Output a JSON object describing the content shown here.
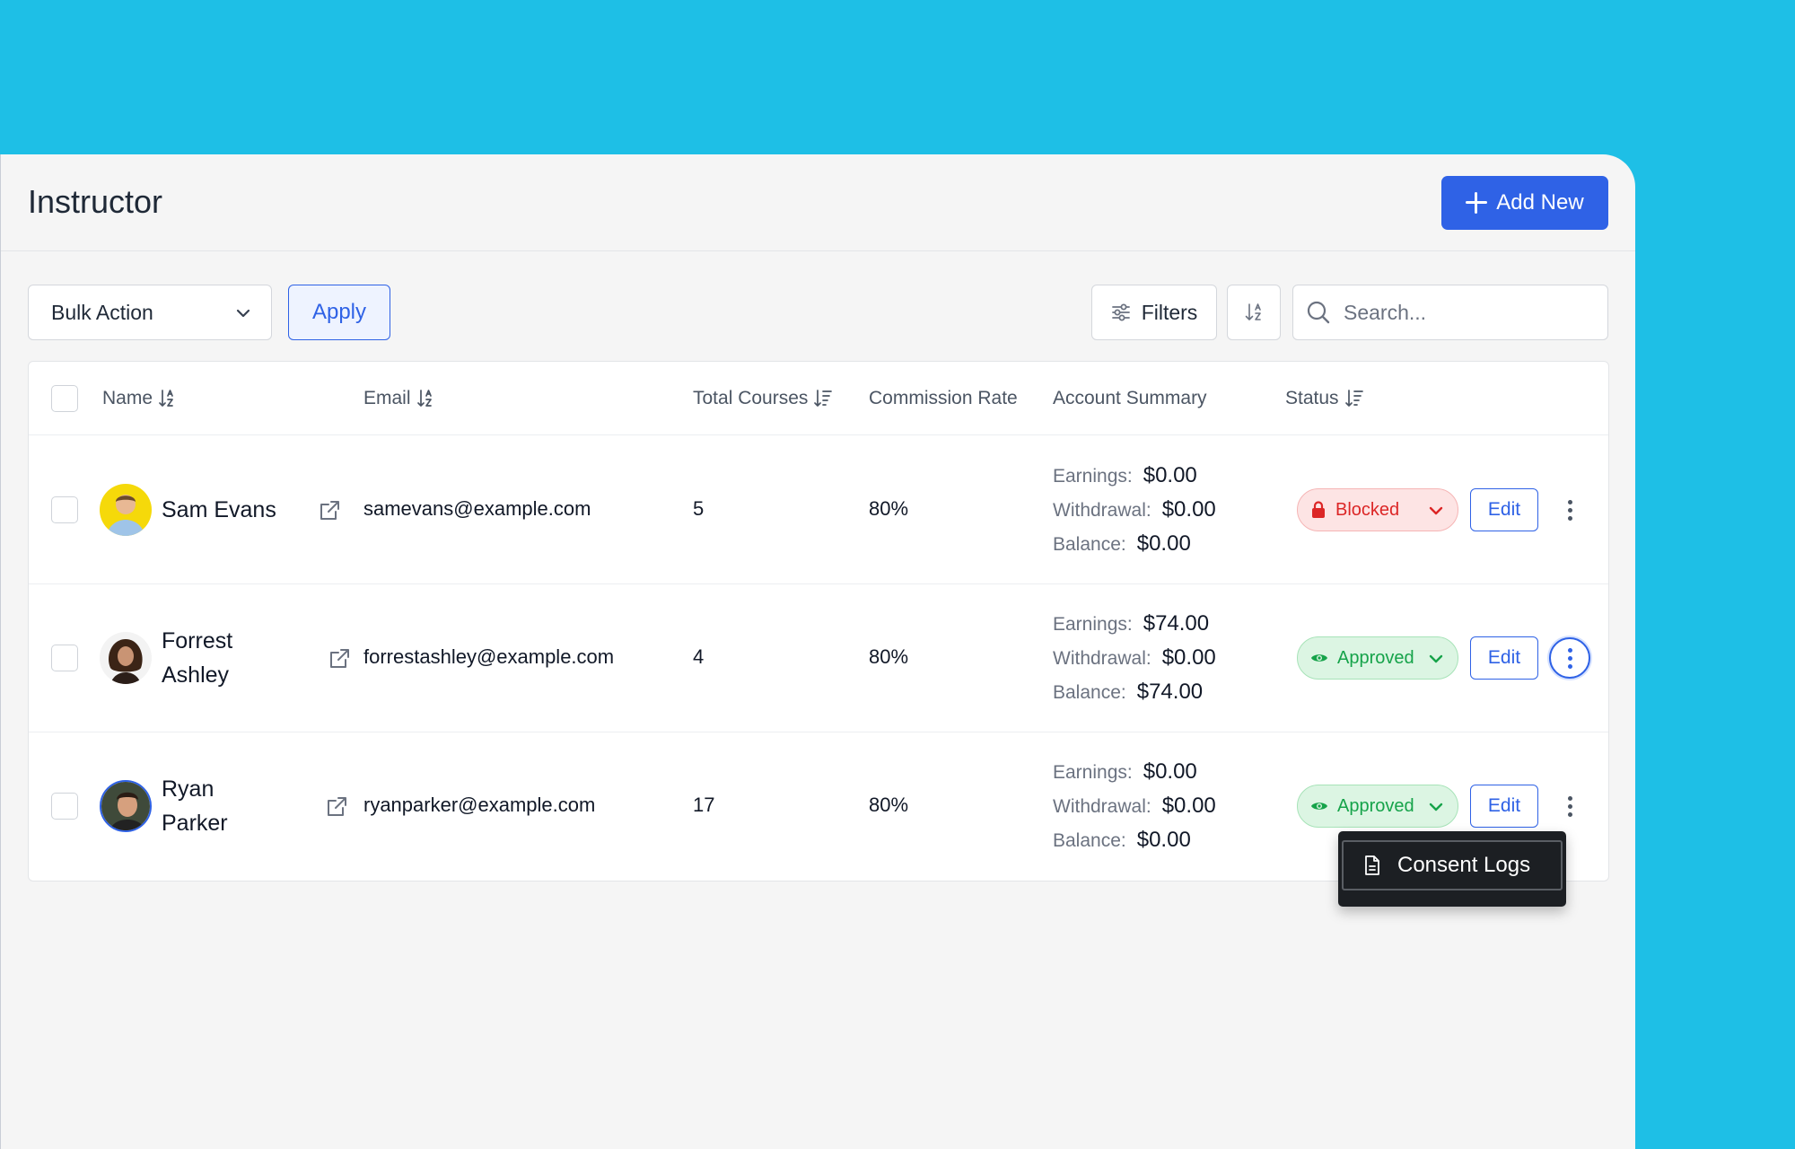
{
  "header": {
    "title": "Instructor",
    "add_new_label": "Add New"
  },
  "toolbar": {
    "bulk_action": "Bulk Action",
    "apply_label": "Apply",
    "filters_label": "Filters",
    "search_placeholder": "Search..."
  },
  "table": {
    "columns": {
      "name": "Name",
      "email": "Email",
      "total_courses": "Total Courses",
      "commission_rate": "Commission Rate",
      "account_summary": "Account Summary",
      "status": "Status"
    },
    "summary_labels": {
      "earnings": "Earnings:",
      "withdrawal": "Withdrawal:",
      "balance": "Balance:"
    },
    "edit_label": "Edit",
    "rows": [
      {
        "name": "Sam Evans",
        "email": "samevans@example.com",
        "total_courses": "5",
        "commission_rate": "80%",
        "earnings": "$0.00",
        "withdrawal": "$0.00",
        "balance": "$0.00",
        "status": "Blocked"
      },
      {
        "name": "Forrest Ashley",
        "email": "forrestashley@example.com",
        "total_courses": "4",
        "commission_rate": "80%",
        "earnings": "$74.00",
        "withdrawal": "$0.00",
        "balance": "$74.00",
        "status": "Approved"
      },
      {
        "name": "Ryan Parker",
        "email": "ryanparker@example.com",
        "total_courses": "17",
        "commission_rate": "80%",
        "earnings": "$0.00",
        "withdrawal": "$0.00",
        "balance": "$0.00",
        "status": "Approved"
      }
    ]
  },
  "row_menu": {
    "items": [
      {
        "label": "Consent Logs",
        "icon": "document-icon"
      }
    ]
  },
  "colors": {
    "background": "#1ebfe6",
    "primary": "#2f62e6",
    "blocked": "#dc2626",
    "approved": "#16a34a"
  }
}
